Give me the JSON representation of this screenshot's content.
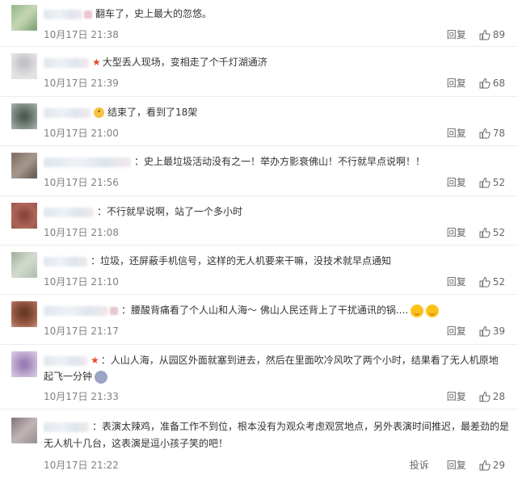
{
  "reply_label": "回复",
  "report_label": "投诉",
  "comments": [
    {
      "text": "翻车了，史上最大的忽悠。",
      "time": "10月17日 21:38",
      "likes": "89"
    },
    {
      "text": "大型丢人现场，变相走了个千灯湖通济",
      "time": "10月17日 21:39",
      "likes": "68"
    },
    {
      "text": "结束了，看到了18架",
      "time": "10月17日 21:00",
      "likes": "78"
    },
    {
      "text": "史上最垃圾活动没有之一！举办方影衰佛山！不行就早点说啊！！",
      "time": "10月17日 21:56",
      "likes": "52"
    },
    {
      "text": "不行就早说啊，站了一个多小时",
      "time": "10月17日 21:08",
      "likes": "52"
    },
    {
      "text": "垃圾，还屏蔽手机信号，这样的无人机要来干嘛，没技术就早点通知",
      "time": "10月17日 21:10",
      "likes": "52"
    },
    {
      "text": "腰酸背痛看了个人山和人海～ 佛山人民还背上了干扰通讯的锅....",
      "time": "10月17日 21:17",
      "likes": "39"
    },
    {
      "text_line1": "人山人海，从园区外面就塞到进去，然后在里面吹冷风吹了两个小时，结果看了无人机原地",
      "text_line2": "起飞一分钟",
      "time": "10月17日 21:33",
      "likes": "28"
    },
    {
      "text_line1": "表演太辣鸡，准备工作不到位，根本没有为观众考虑观赏地点，另外表演时间推迟，最差劲的是",
      "text_line2": "无人机十几台，这表演是逗小孩子笑的吧！",
      "time": "10月17日 21:22",
      "likes": "29"
    }
  ]
}
